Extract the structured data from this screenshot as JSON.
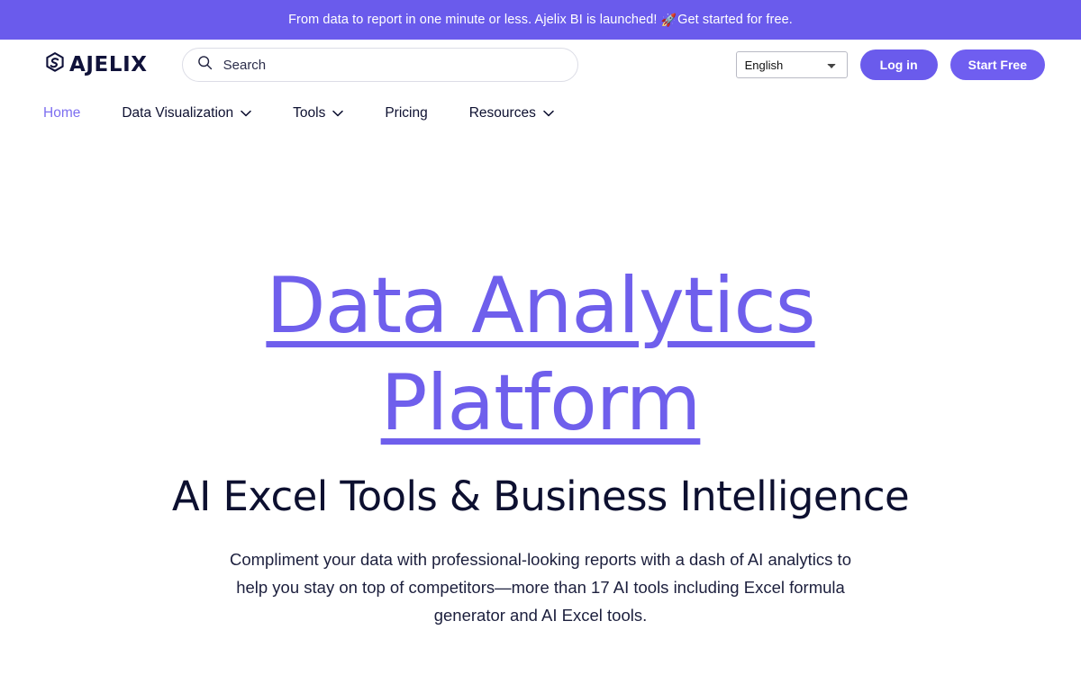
{
  "announcement": {
    "text": "From data to report in one minute or less. Ajelix BI is launched!",
    "emoji": "🚀",
    "link_label": "Get started for free.",
    "background": "#6a5bec"
  },
  "header": {
    "logo_text": "AJELIX",
    "logo_icon": "ajelix-hex-logo-icon",
    "search": {
      "icon": "search-icon",
      "placeholder": "Search",
      "value": ""
    },
    "language": {
      "selected": "English",
      "options": [
        "English"
      ]
    },
    "login_label": "Log in",
    "start_free_label": "Start Free"
  },
  "nav": {
    "items": [
      {
        "label": "Home",
        "has_dropdown": false,
        "active": true
      },
      {
        "label": "Data Visualization",
        "has_dropdown": true,
        "active": false
      },
      {
        "label": "Tools",
        "has_dropdown": true,
        "active": false
      },
      {
        "label": "Pricing",
        "has_dropdown": false,
        "active": false
      },
      {
        "label": "Resources",
        "has_dropdown": true,
        "active": false
      }
    ]
  },
  "hero": {
    "title_line1": "Data Analytics",
    "title_line2": "Platform",
    "title_color": "#6f5fec",
    "subtitle": "AI Excel Tools & Business Intelligence",
    "description": "Compliment your data with professional-looking reports with a dash of AI analytics to help you stay on top of competitors—more than 17 AI tools including Excel formula generator and AI Excel tools."
  }
}
